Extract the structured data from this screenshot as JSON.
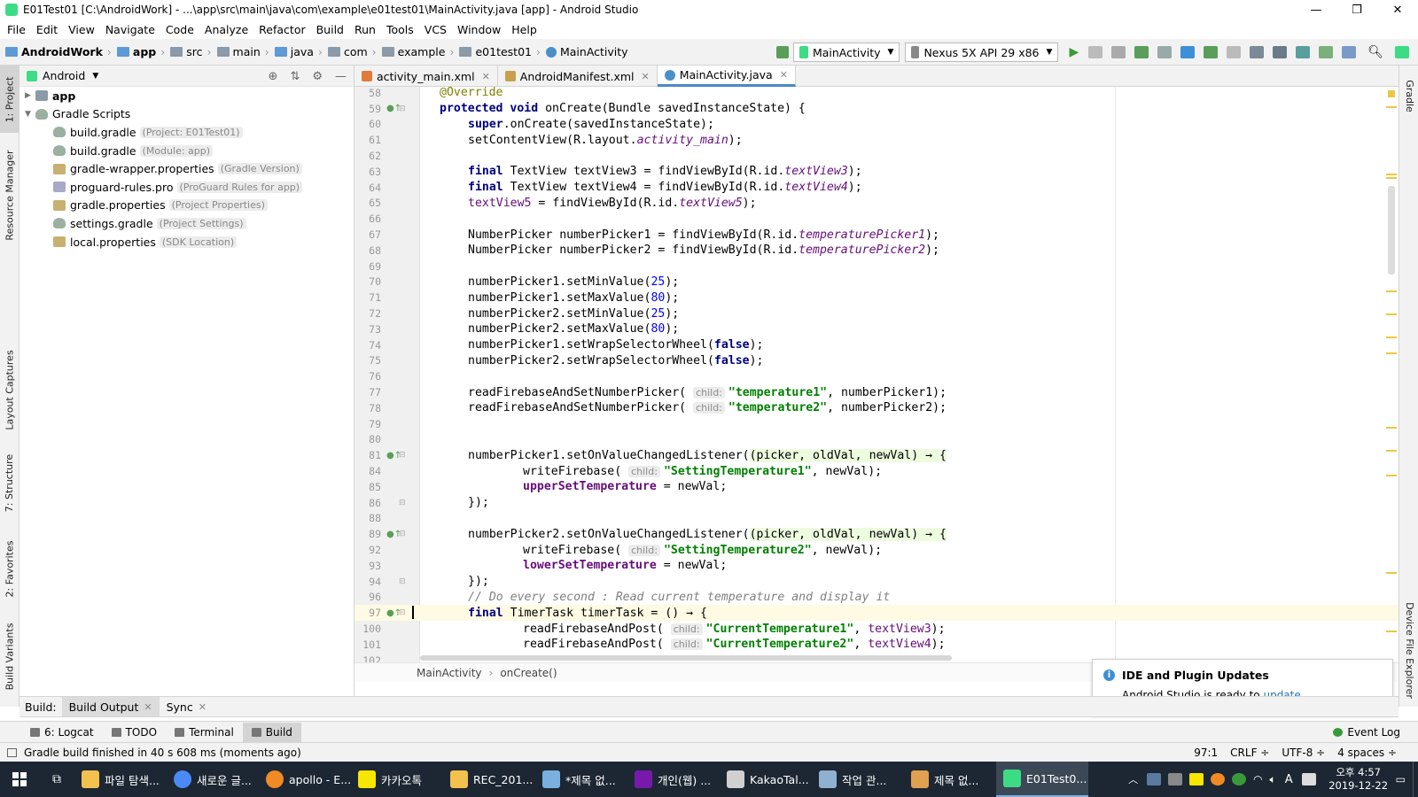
{
  "window": {
    "title": "E01Test01 [C:\\AndroidWork] - ...\\app\\src\\main\\java\\com\\example\\e01test01\\MainActivity.java [app] - Android Studio",
    "minimize": "—",
    "maximize": "❐",
    "close": "✕"
  },
  "menu": [
    "File",
    "Edit",
    "View",
    "Navigate",
    "Code",
    "Analyze",
    "Refactor",
    "Build",
    "Run",
    "Tools",
    "VCS",
    "Window",
    "Help"
  ],
  "breadcrumbs": [
    "AndroidWork",
    "app",
    "src",
    "main",
    "java",
    "com",
    "example",
    "e01test01",
    "MainActivity"
  ],
  "run_config": "MainActivity",
  "device": "Nexus 5X API 29 x86",
  "left_tabs": [
    "1: Project",
    "Resource Manager",
    "Layout Captures",
    "7: Structure",
    "2: Favorites",
    "Build Variants"
  ],
  "right_tabs": [
    "Gradle",
    "Device File Explorer"
  ],
  "project": {
    "view": "Android",
    "items": [
      {
        "name": "app",
        "hint": ""
      },
      {
        "name": "Gradle Scripts",
        "hint": ""
      },
      {
        "name": "build.gradle",
        "hint": "(Project: E01Test01)"
      },
      {
        "name": "build.gradle",
        "hint": "(Module: app)"
      },
      {
        "name": "gradle-wrapper.properties",
        "hint": "(Gradle Version)"
      },
      {
        "name": "proguard-rules.pro",
        "hint": "(ProGuard Rules for app)"
      },
      {
        "name": "gradle.properties",
        "hint": "(Project Properties)"
      },
      {
        "name": "settings.gradle",
        "hint": "(Project Settings)"
      },
      {
        "name": "local.properties",
        "hint": "(SDK Location)"
      }
    ]
  },
  "editor_tabs": [
    {
      "label": "activity_main.xml",
      "color": "#e07b39"
    },
    {
      "label": "AndroidManifest.xml",
      "color": "#c8a050"
    },
    {
      "label": "MainActivity.java",
      "color": "#4a90c8"
    }
  ],
  "line_numbers": [
    "58",
    "59",
    "60",
    "61",
    "62",
    "63",
    "64",
    "65",
    "66",
    "67",
    "68",
    "69",
    "70",
    "71",
    "72",
    "73",
    "74",
    "75",
    "76",
    "77",
    "78",
    "79",
    "80",
    "81",
    "84",
    "85",
    "86",
    "88",
    "89",
    "92",
    "93",
    "94",
    "96",
    "97",
    "100",
    "101",
    "102"
  ],
  "code": {
    "l58": "@Override",
    "l59a": "protected void ",
    "l59b": "onCreate(Bundle savedInstanceState) {",
    "l60a": "super",
    "l60b": ".onCreate(savedInstanceState);",
    "l61a": "setContentView(R.layout.",
    "l61b": "activity_main",
    "l61c": ");",
    "l63a": "final ",
    "l63b": "TextView textView3 = findViewById(R.id.",
    "l63c": "textView3",
    "l63d": ");",
    "l64a": "final ",
    "l64b": "TextView textView4 = findViewById(R.id.",
    "l64c": "textView4",
    "l64d": ");",
    "l65a": "textView5",
    "l65b": " = findViewById(R.id.",
    "l65c": "textView5",
    "l65d": ");",
    "l67a": "NumberPicker numberPicker1 = findViewById(R.id.",
    "l67b": "temperaturePicker1",
    "l67c": ");",
    "l68a": "NumberPicker numberPicker2 = findViewById(R.id.",
    "l68b": "temperaturePicker2",
    "l68c": ");",
    "l70a": "numberPicker1.setMinValue(",
    "l70b": "25",
    "l70c": ");",
    "l71a": "numberPicker1.setMaxValue(",
    "l71b": "80",
    "l71c": ");",
    "l72a": "numberPicker2.setMinValue(",
    "l72b": "25",
    "l72c": ");",
    "l73a": "numberPicker2.setMaxValue(",
    "l73b": "80",
    "l73c": ");",
    "l74a": "numberPicker1.setWrapSelectorWheel(",
    "l74b": "false",
    "l74c": ");",
    "l75a": "numberPicker2.setWrapSelectorWheel(",
    "l75b": "false",
    "l75c": ");",
    "hint_child": "child:",
    "l77a": "readFirebaseAndSetNumberPicker(",
    "l77b": "\"temperature1\"",
    "l77c": ", numberPicker1);",
    "l78a": "readFirebaseAndSetNumberPicker(",
    "l78b": "\"temperature2\"",
    "l78c": ", numberPicker2);",
    "l81a": "numberPicker1.setOnValueChangedListener(",
    "l81b": "(picker, oldVal, newVal) → {",
    "l84a": "writeFirebase(",
    "l84b": "\"SettingTemperature1\"",
    "l84c": ", newVal);",
    "l85a": "upperSetTemperature",
    "l85b": " = newVal;",
    "l86": "});",
    "l89a": "numberPicker2.setOnValueChangedListener(",
    "l89b": "(picker, oldVal, newVal) → {",
    "l92a": "writeFirebase(",
    "l92b": "\"SettingTemperature2\"",
    "l92c": ", newVal);",
    "l93a": "lowerSetTemperature",
    "l93b": " = newVal;",
    "l94": "});",
    "l96": "// Do every second : Read current temperature and display it",
    "l97a": "final ",
    "l97b": "TimerTask timerTask = () → {",
    "l100a": "readFirebaseAndPost(",
    "l100b": "\"CurrentTemperature1\"",
    "l100c": ", ",
    "l100d": "textView3",
    "l100e": ");",
    "l101a": "readFirebaseAndPost(",
    "l101b": "\"CurrentTemperature2\"",
    "l101c": ", ",
    "l101d": "textView4",
    "l101e": ");"
  },
  "editor_breadcrumb": [
    "MainActivity",
    "onCreate()"
  ],
  "build_panel": {
    "label": "Build:",
    "tabs": [
      "Build Output",
      "Sync"
    ]
  },
  "toolwindows": [
    "6: Logcat",
    "TODO",
    "Terminal",
    "Build"
  ],
  "event_log": "Event Log",
  "status": {
    "message": "Gradle build finished in 40 s 608 ms (moments ago)",
    "position": "97:1",
    "line_sep": "CRLF ÷",
    "encoding": "UTF-8 ÷",
    "indent": "4 spaces ÷"
  },
  "notification": {
    "title": "IDE and Plugin Updates",
    "body": "Android Studio is ready to",
    "link": "update."
  },
  "taskbar": {
    "apps": [
      {
        "label": "파일 탐색...",
        "color": "#f2c14e"
      },
      {
        "label": "새로운 글...",
        "color": "#4a8af4"
      },
      {
        "label": "apollo - E...",
        "color": "#f08a24"
      },
      {
        "label": "카카오톡",
        "color": "#f7e600"
      },
      {
        "label": "REC_201...",
        "color": "#f2c14e"
      },
      {
        "label": "*제목 없...",
        "color": "#7ab0e0"
      },
      {
        "label": "개인(웹) ...",
        "color": "#7719aa"
      },
      {
        "label": "KakaoTal...",
        "color": "#d0d0d0"
      },
      {
        "label": "작업 관...",
        "color": "#90b0d0"
      },
      {
        "label": "제목 없...",
        "color": "#e0a050"
      },
      {
        "label": "E01Test0...",
        "color": "#3ddc84"
      }
    ],
    "time": "오후 4:57",
    "date": "2019-12-22",
    "ime": "A"
  }
}
